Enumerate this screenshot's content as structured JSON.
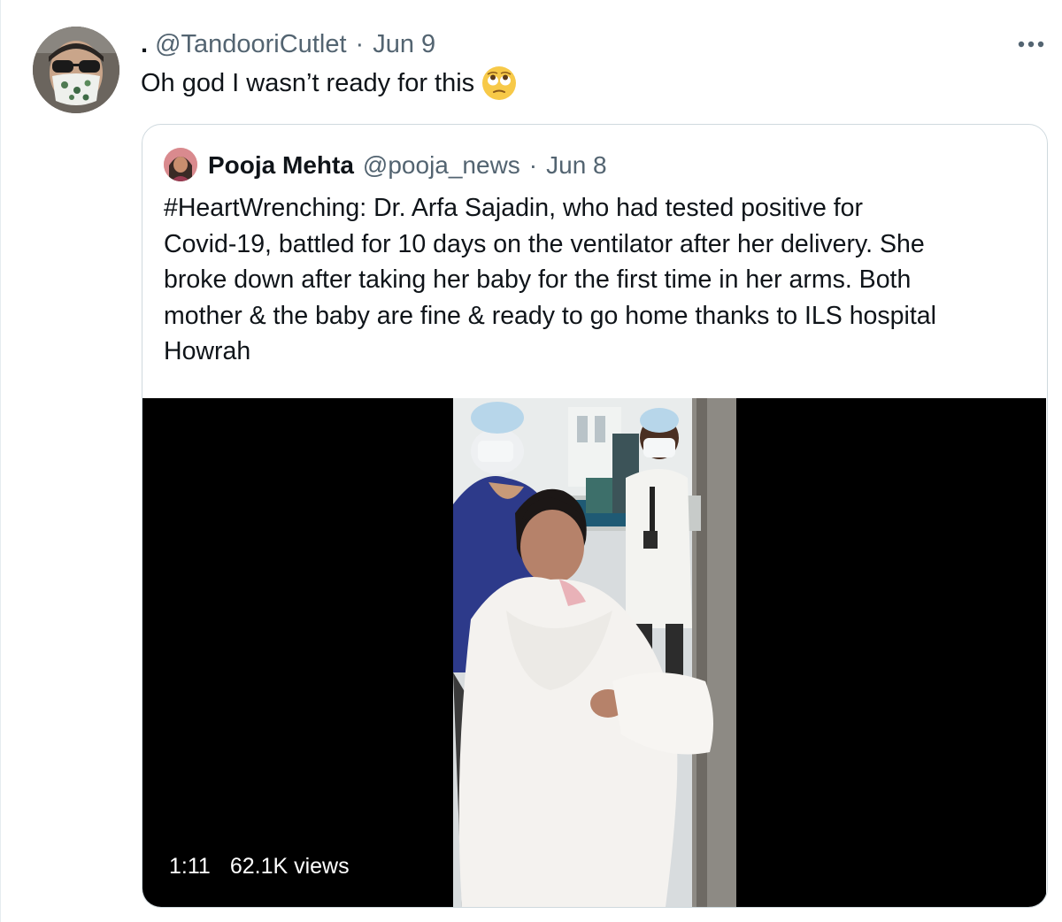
{
  "tweet": {
    "display_name": ".",
    "handle": "@TandooriCutlet",
    "separator": "·",
    "date": "Jun 9",
    "text": "Oh god I wasn’t ready for this",
    "emoji": "face-with-rolling-eyes",
    "more_icon": "more-dots-icon"
  },
  "quoted_tweet": {
    "display_name": "Pooja Mehta",
    "handle": "@pooja_news",
    "separator": "·",
    "date": "Jun 8",
    "text_lines": [
      "#HeartWrenching: Dr. Arfa Sajadin, who had tested positive for",
      "Covid-19, battled for 10 days on the ventilator after her delivery. She",
      "broke down after taking her baby for the first time in her arms. Both",
      "mother & the baby are fine & ready to go home thanks to ILS hospital",
      "Howrah"
    ],
    "video": {
      "duration": "1:11",
      "views": "62.1K views"
    }
  },
  "colors": {
    "text_primary": "#0f1419",
    "text_secondary": "#536471",
    "border": "#cfd9de",
    "video_background": "#000000"
  }
}
